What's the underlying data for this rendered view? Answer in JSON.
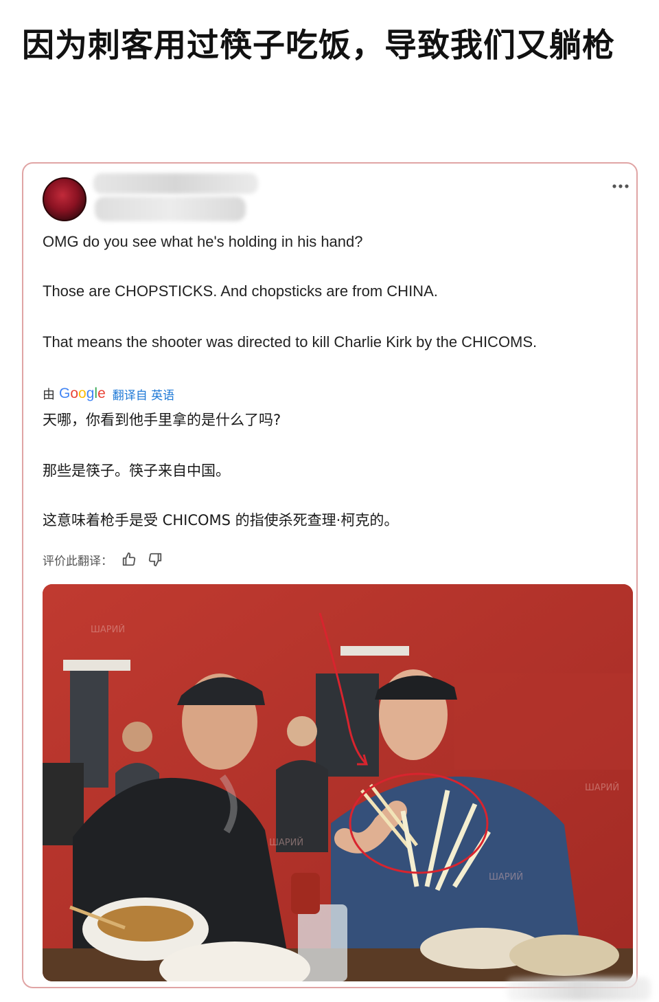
{
  "headline": "因为刺客用过筷子吃饭，导致我们又躺枪",
  "post": {
    "more_icon": "more-horizontal-icon",
    "original_text": [
      "OMG do you see what he's holding in his hand?",
      "Those are CHOPSTICKS. And chopsticks are from CHINA.",
      "That means the shooter was directed to kill Charlie Kirk by the CHICOMS."
    ],
    "translation": {
      "by_label": "由",
      "provider": "Google",
      "translated_from": "翻译自 英语",
      "lines": [
        "天哪，你看到他手里拿的是什么了吗?",
        "那些是筷子。筷子来自中国。",
        "这意味着枪手是受 CHICOMS 的指使杀死查理·柯克的。"
      ]
    },
    "rate_label": "评价此翻译：",
    "thumbs_up_icon": "thumbs-up-icon",
    "thumbs_down_icon": "thumbs-down-icon"
  },
  "photo": {
    "watermark_text": "ШАРИЙ"
  },
  "colors": {
    "card_border": "#e0a4a4",
    "translate_link": "#1d78d6",
    "annotation_red": "#d8242e"
  }
}
